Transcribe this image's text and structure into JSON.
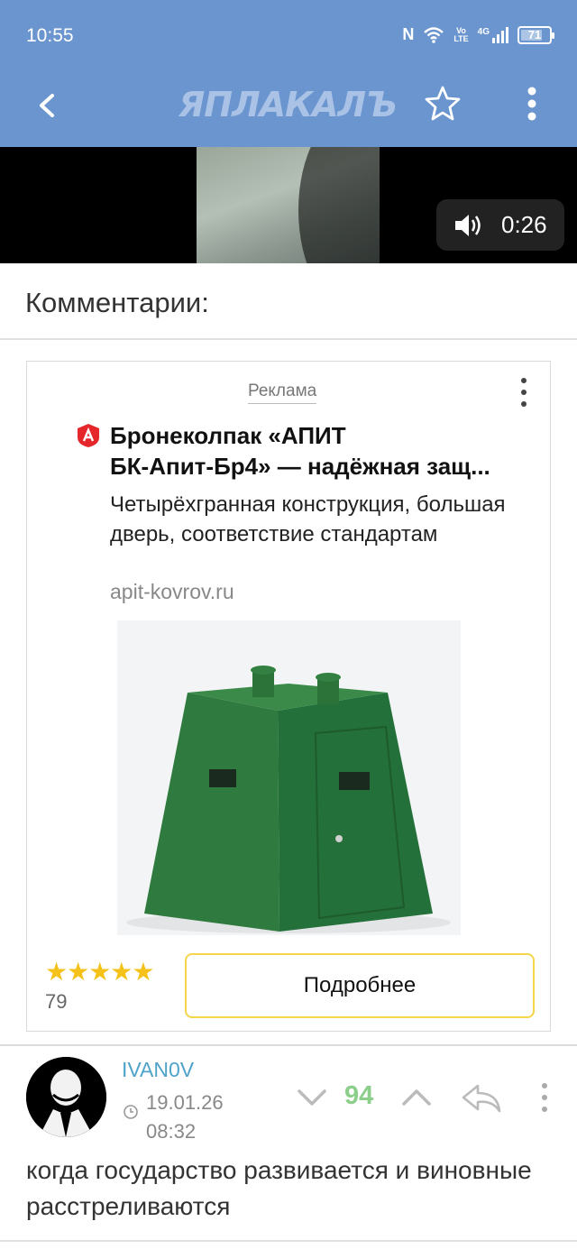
{
  "status_bar": {
    "time": "10:55",
    "nfc": "N",
    "network_vo": "Vo",
    "network_lte": "LTE",
    "network_4g": "4G",
    "battery": "71"
  },
  "header": {
    "logo_text": "ЯПЛАКАЛЪ",
    "icons": [
      "back-arrow-icon",
      "star-icon",
      "more-vertical-icon"
    ],
    "background": "#6a95cf"
  },
  "video": {
    "duration": "0:26",
    "icon": "speaker-icon"
  },
  "comments": {
    "title": "Комментарии:"
  },
  "ad": {
    "label": "Реклама",
    "title_line1": "Бронеколпак «АПИТ",
    "title_line2": "БК-Апит-Бр4» — надёжная защ...",
    "description": "Четырёхгранная конструкция, большая дверь, соответствие стандартам",
    "url": "apit-kovrov.ru",
    "rating_stars": "★★★★★",
    "rating_value": 5,
    "rating_count": "79",
    "button_label": "Подробнее",
    "accent": "#f4c21a"
  },
  "comment": {
    "username": "IVAN0V",
    "date_line1": "19.01.26",
    "date_line2": "08:32",
    "score": "94",
    "score_color": "#8bcf8b",
    "text": "когда государство развивается и виновные расстреливаются"
  }
}
